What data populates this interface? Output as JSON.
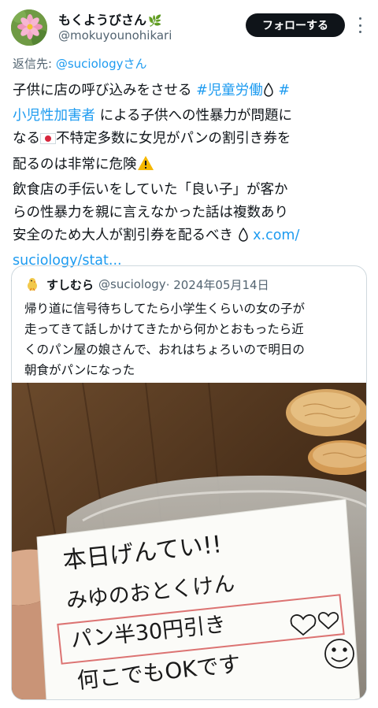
{
  "author": {
    "display_name": "もくようびさん",
    "handle": "@mokuyounohikari",
    "avatar_icon": "cosmos-flower-avatar",
    "badge_icon": "leaf-icon"
  },
  "follow_button": {
    "label": "フォローする"
  },
  "more_icon": "more-vertical-icon",
  "reply": {
    "prefix": "返信先: ",
    "target": "@suciologyさん"
  },
  "tweet": {
    "line1": {
      "text": "子供に店の呼び込みをさせる ",
      "tag1": "#児童労働",
      "tag2": "#"
    },
    "line2": {
      "tag": "小児性加害者",
      "text": " による子供への性暴力が問題に"
    },
    "line3": {
      "pre": "なる",
      "text": "不特定多数に女児がパンの割引き券を"
    },
    "line4": {
      "text": "配るのは非常に危険"
    },
    "line5": {
      "text": "飲食店の手伝いをしていた「良い子」が客か"
    },
    "line6": {
      "text": "らの性暴力を親に言えなかった話は複数あり"
    },
    "line7": {
      "text": "安全のため大人が割引券を配るべき",
      "url": "x.com/"
    },
    "line8": {
      "url": "suciology/stat..."
    }
  },
  "quote": {
    "name": "すしむら",
    "handle": "@suciology",
    "date": " · 2024年05月14日",
    "lines": [
      "帰り道に信号待ちしてたら小学生くらいの女の子が",
      "走ってきて話しかけてきたから何かとおもったら近",
      "くのパン屋の娘さんで、おれはちょろいので明日の",
      "朝食がパンになった"
    ]
  },
  "photo_note": {
    "line1": "本日げんてい!!",
    "line2": "みゆのおとくけん",
    "line3": "パン半30円引き",
    "line4": "何こでもOKです"
  },
  "colors": {
    "link": "#1d9bf0",
    "text": "#0f1419",
    "secondary": "#536471",
    "border": "#cfd9de",
    "button_bg": "#0f1419"
  }
}
